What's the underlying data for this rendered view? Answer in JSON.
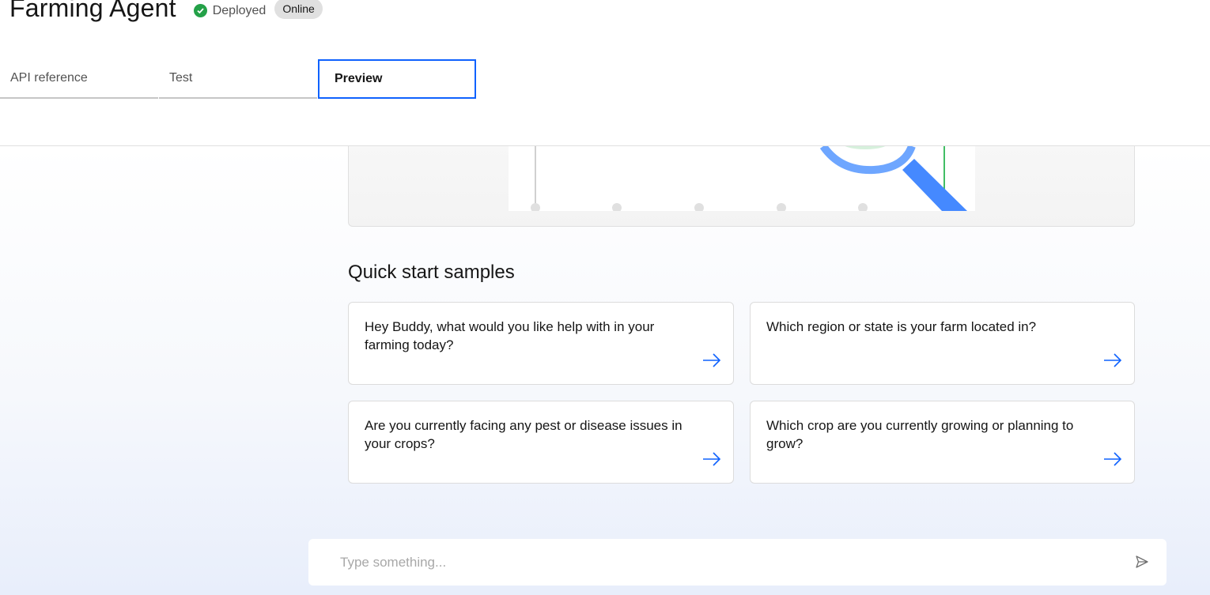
{
  "header": {
    "title": "Farming Agent",
    "status_label": "Deployed",
    "status_badge": "Online",
    "status_icon": "checkmark-filled-icon",
    "status_color": "#24a148"
  },
  "tabs": [
    {
      "label": "API reference",
      "active": false
    },
    {
      "label": "Test",
      "active": false
    },
    {
      "label": "Preview",
      "active": true
    }
  ],
  "quick_start": {
    "title": "Quick start samples",
    "samples": [
      {
        "text": "Hey Buddy, what would you like help with in your farming today?",
        "icon": "arrow-right-icon"
      },
      {
        "text": "Which region or state is your farm located in?",
        "icon": "arrow-right-icon"
      },
      {
        "text": "Are you currently facing any pest or disease issues in your crops?",
        "icon": "arrow-right-icon"
      },
      {
        "text": "Which crop are you currently growing or planning to grow?",
        "icon": "arrow-right-icon"
      }
    ]
  },
  "chat": {
    "placeholder": "Type something...",
    "send_icon": "send-icon"
  },
  "colors": {
    "accent": "#0f62fe",
    "text": "#161616",
    "muted": "#525252"
  }
}
